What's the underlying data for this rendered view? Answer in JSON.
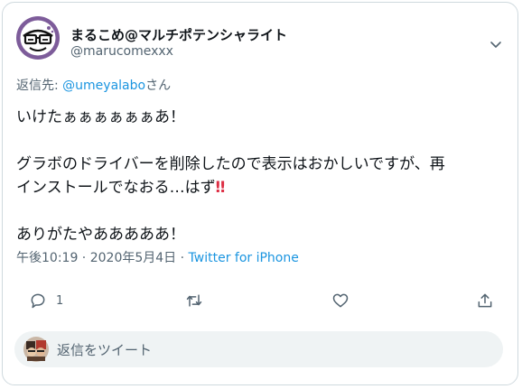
{
  "tweet": {
    "author_name": "まるこめ@マルチポテンシャライト",
    "author_handle": "@marucomexxx",
    "reply_prefix": "返信先: ",
    "reply_mention": "@umeyalabo",
    "reply_suffix": "さん",
    "lines": [
      "いけたぁぁぁぁぁぁあ！",
      "グラボのドライバーを削除したので表示はおかしいですが、再",
      "インストールでなおる…はず",
      "ありがたやあああああ！"
    ],
    "emphasis": "‼",
    "time": "午後10:19",
    "separator1": " · ",
    "date": "2020年5月4日",
    "separator2": " · ",
    "source": "Twitter for iPhone"
  },
  "actions": {
    "reply_count": "1"
  },
  "compose": {
    "placeholder": "返信をツイート"
  },
  "icons": {
    "chevron": "chevron-down-icon",
    "reply": "reply-icon",
    "retweet": "retweet-icon",
    "like": "heart-icon",
    "share": "share-icon"
  },
  "colors": {
    "accent": "#1b95e0",
    "secondary_text": "#536471",
    "primary_text": "#0f1419",
    "avatar_ring": "#7d5c9a",
    "emphasis": "#dd2e44"
  }
}
